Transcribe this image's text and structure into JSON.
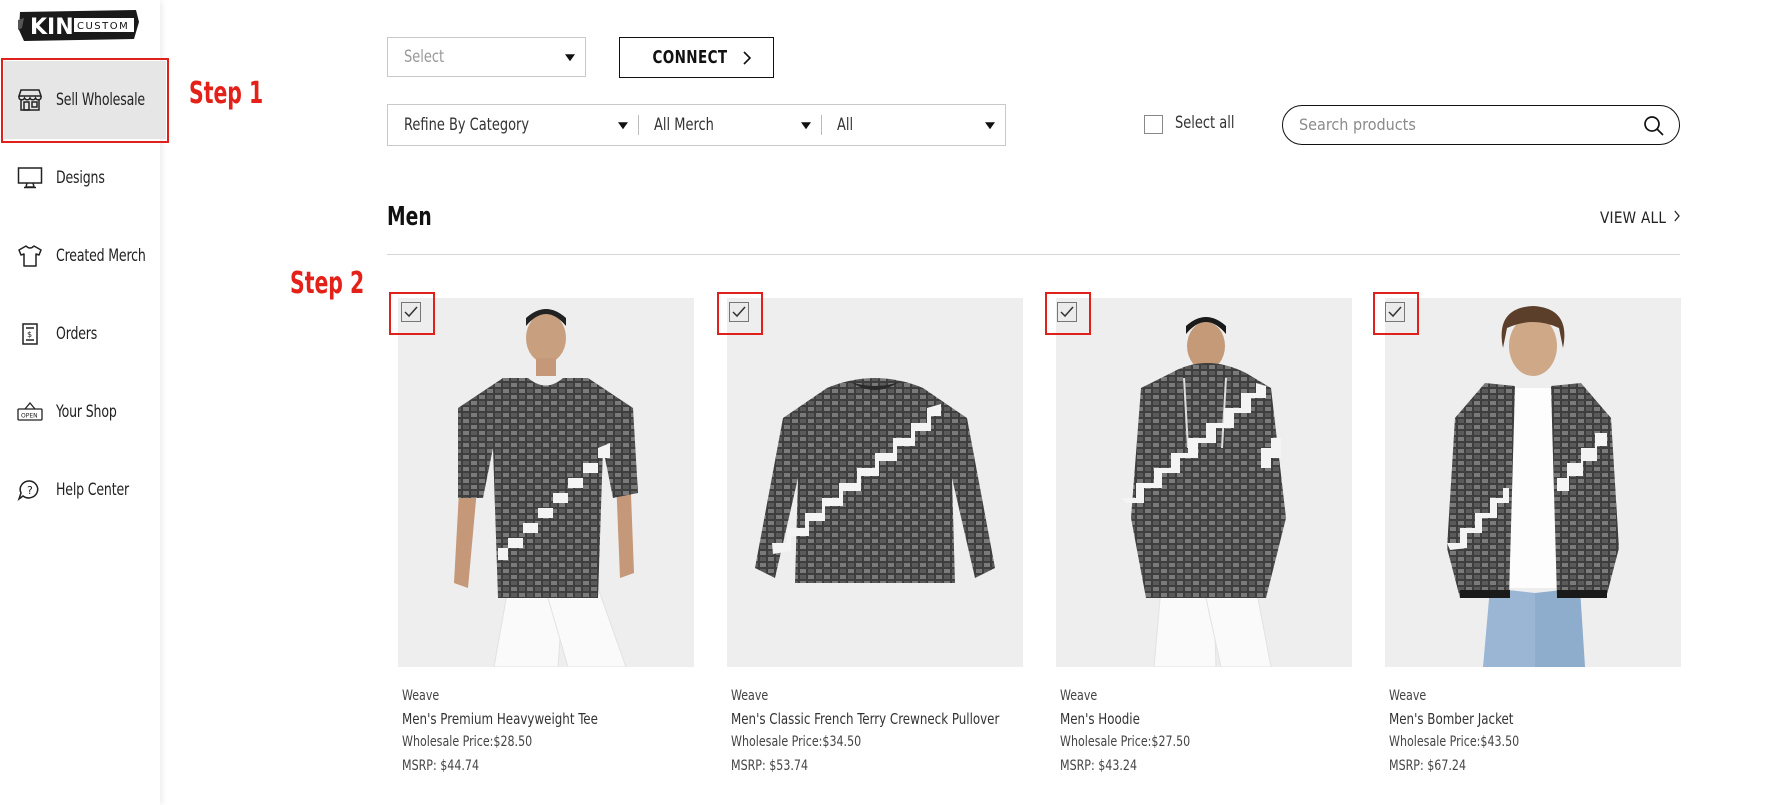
{
  "app": {
    "logo_main": "KIN",
    "logo_sub": "CUSTOM"
  },
  "sidebar": {
    "items": [
      {
        "label": "Sell Wholesale",
        "icon": "storefront-icon",
        "active": true
      },
      {
        "label": "Designs",
        "icon": "monitor-icon"
      },
      {
        "label": "Created Merch",
        "icon": "tshirt-icon"
      },
      {
        "label": "Orders",
        "icon": "receipt-icon"
      },
      {
        "label": "Your Shop",
        "icon": "open-sign-icon"
      },
      {
        "label": "Help Center",
        "icon": "help-bubble-icon"
      }
    ]
  },
  "annotations": {
    "step1": "Step 1",
    "step2": "Step 2",
    "color": "#e32119"
  },
  "toolbar": {
    "store_select_placeholder": "Select",
    "connect_label": "CONNECT",
    "category_filter": "Refine By Category",
    "merch_filter": "All Merch",
    "sub_filter": "All",
    "select_all_label": "Select all",
    "search_placeholder": "Search products"
  },
  "section": {
    "title": "Men",
    "view_all": "VIEW ALL"
  },
  "products": [
    {
      "design": "Weave",
      "name": "Men's Premium Heavyweight Tee",
      "wholesale": "Wholesale Price:$28.50",
      "msrp": "MSRP: $44.74",
      "checked": true,
      "type": "tee"
    },
    {
      "design": "Weave",
      "name": "Men's Classic French Terry Crewneck Pullover",
      "wholesale": "Wholesale Price:$34.50",
      "msrp": "MSRP: $53.74",
      "checked": true,
      "type": "sweater"
    },
    {
      "design": "Weave",
      "name": "Men's Hoodie",
      "wholesale": "Wholesale Price:$27.50",
      "msrp": "MSRP: $43.24",
      "checked": true,
      "type": "hoodie"
    },
    {
      "design": "Weave",
      "name": "Men's Bomber Jacket",
      "wholesale": "Wholesale Price:$43.50",
      "msrp": "MSRP: $67.24",
      "checked": true,
      "type": "bomber"
    }
  ]
}
